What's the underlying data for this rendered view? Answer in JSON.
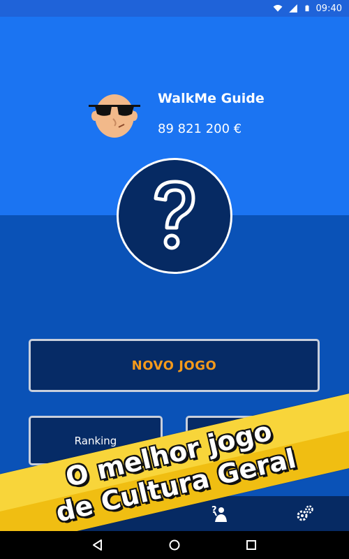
{
  "status_bar": {
    "time": "09:40"
  },
  "player": {
    "name": "WalkMe Guide",
    "money": "89 821 200 €"
  },
  "buttons": {
    "new_game": "NOVO JOGO",
    "ranking": "Ranking",
    "right_button": ""
  },
  "banner": {
    "line1": "O melhor jogo",
    "line2": "de Cultura Geral"
  },
  "colors": {
    "top_blue": "#1b74f2",
    "bottom_blue": "#0a52b7",
    "dark_navy": "#062a63",
    "accent_orange": "#f59a1b",
    "banner_yellow": "#f5c91e"
  },
  "icons": {
    "status": [
      "wifi-icon",
      "signal-icon",
      "battery-icon"
    ],
    "bottom_bar": [
      "quiz-player-icon",
      "settings-gears-icon"
    ],
    "nav": [
      "back-icon",
      "home-icon",
      "recents-icon"
    ]
  }
}
